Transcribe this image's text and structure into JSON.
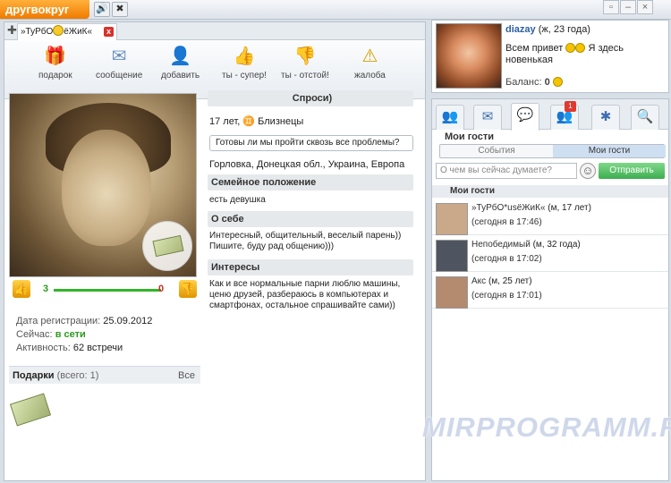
{
  "app": {
    "logo": "другвокруг"
  },
  "tab": {
    "title_prefix": "»ТуРбО",
    "title_suffix": "ёЖиК«",
    "close": "x"
  },
  "toolbar": {
    "gift": "подарок",
    "message": "сообщение",
    "add": "добавить",
    "super": "ты - супер!",
    "bad": "ты - отстой!",
    "complain": "жалоба"
  },
  "profile": {
    "ask_title": "Спроси)",
    "age_sign": "17 лет,",
    "zodiac": "Близнецы",
    "question": "Готовы ли мы пройти сквозь все проблемы?",
    "location": "Горловка, Донецкая обл., Украина, Европа",
    "family_h": "Семейное положение",
    "family": "есть девушка",
    "about_h": "О себе",
    "about": "Интересный, общительный, веселый парень)) Пишите, буду рад общению)))",
    "interests_h": "Интересы",
    "interests": "Как и все нормальные парни люблю машины, ценю друзей,  разбераюсь в компьютерах и смартфонах, остальное спрашивайте сами))"
  },
  "votes": {
    "up": "3",
    "down": "0"
  },
  "meta": {
    "reg_label": "Дата регистрации:",
    "reg_value": "25.09.2012",
    "now_label": "Сейчас:",
    "now_value": "в сети",
    "act_label": "Активность:",
    "act_value": "62 встречи"
  },
  "gifts": {
    "label": "Подарки",
    "count": "(всего: 1)",
    "all": "Все"
  },
  "me": {
    "name": "diazay",
    "info": "(ж, 23 года)",
    "status_1": "Всем привет",
    "status_2": "Я здесь",
    "status_3": "новенькая",
    "balance_label": "Баланс:",
    "balance": "0"
  },
  "right": {
    "badge": "1",
    "title": "Мои гости",
    "seg_events": "События",
    "seg_guests": "Мои гости",
    "compose_placeholder": "О чем вы сейчас думаете?",
    "send": "Отправить",
    "list_head": "Мои гости",
    "guests": [
      {
        "name": "»ТуРбО*usёЖиК«",
        "info": "(м, 17 лет)",
        "time": "(сегодня в 17:46)"
      },
      {
        "name": "Непобедимый",
        "info": "(м, 32 года)",
        "time": "(сегодня в 17:02)"
      },
      {
        "name": "Акс",
        "info": "(м, 25 лет)",
        "time": "(сегодня в 17:01)"
      }
    ]
  },
  "watermark": "MIRPROGRAMM.RU",
  "colors": {
    "accent": "#f07a00",
    "online": "#2c9b1e",
    "send": "#3dae4f",
    "badge": "#e03a2f"
  }
}
